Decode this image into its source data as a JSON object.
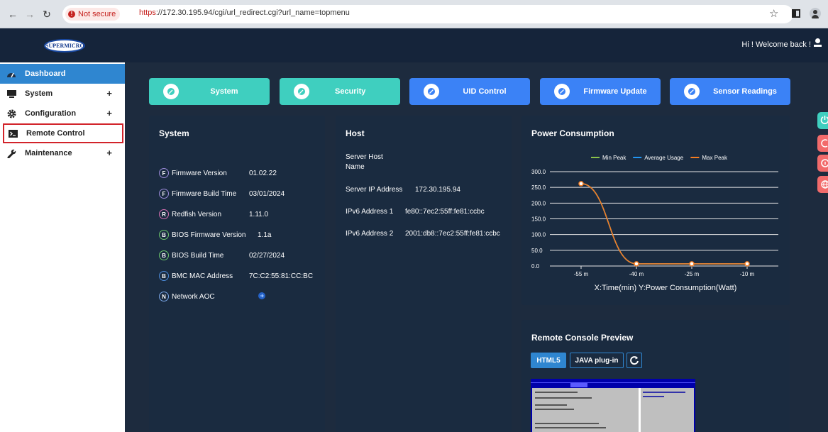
{
  "browser": {
    "not_secure": "Not secure",
    "url_scheme": "https",
    "url_rest": "://172.30.195.94/cgi/url_redirect.cgi?url_name=topmenu"
  },
  "header": {
    "logo": "SUPERMICRO",
    "welcome": "Hi ! Welcome back !"
  },
  "sidebar": {
    "items": [
      {
        "label": "Dashboard",
        "icon": "dashboard-icon",
        "expandable": false
      },
      {
        "label": "System",
        "icon": "monitor-icon",
        "expandable": true
      },
      {
        "label": "Configuration",
        "icon": "gear-icon",
        "expandable": true
      },
      {
        "label": "Remote Control",
        "icon": "terminal-icon",
        "expandable": false
      },
      {
        "label": "Maintenance",
        "icon": "wrench-icon",
        "expandable": true
      }
    ],
    "plus": "+"
  },
  "tabs": [
    {
      "label": "System",
      "color": "#3fcfbf"
    },
    {
      "label": "Security",
      "color": "#3fcfbf"
    },
    {
      "label": "UID Control",
      "color": "#3b82f6"
    },
    {
      "label": "Firmware Update",
      "color": "#3b82f6"
    },
    {
      "label": "Sensor Readings",
      "color": "#3b82f6"
    }
  ],
  "system_panel": {
    "title": "System",
    "rows": [
      {
        "badge": "F",
        "label": "Firmware Version",
        "value": "01.02.22"
      },
      {
        "badge": "F",
        "label": "Firmware Build Time",
        "value": "03/01/2024"
      },
      {
        "badge": "R",
        "label": "Redfish Version",
        "value": "1.11.0"
      },
      {
        "badge": "B",
        "label": "BIOS Firmware Version",
        "value": "1.1a"
      },
      {
        "badge": "B",
        "label": "BIOS Build Time",
        "value": "02/27/2024"
      },
      {
        "badge": "B",
        "label": "BMC MAC Address",
        "value": "7C:C2:55:81:CC:BC"
      },
      {
        "badge": "N",
        "label": "Network AOC",
        "value": ""
      }
    ]
  },
  "host_panel": {
    "title": "Host",
    "rows": [
      {
        "label": "Server Host",
        "value": ""
      },
      {
        "label": "Name",
        "value": ""
      },
      {
        "label": "Server IP Address",
        "value": "172.30.195.94"
      },
      {
        "label": "IPv6 Address 1",
        "value": "fe80::7ec2:55ff:fe81:ccbc"
      },
      {
        "label": "IPv6 Address 2",
        "value": "2001:db8::7ec2:55ff:fe81:ccbc"
      }
    ]
  },
  "power_panel": {
    "title": "Power Consumption"
  },
  "chart_data": {
    "type": "line",
    "title": "",
    "xlabel": "X:Time(min) Y:Power Consumption(Watt)",
    "ylabel": "",
    "categories": [
      "-55 m",
      "-40 m",
      "-25 m",
      "-10 m"
    ],
    "y_ticks": [
      "300.0",
      "250.0",
      "200.0",
      "150.0",
      "100.0",
      "50.0",
      "0.0"
    ],
    "ylim": [
      0,
      300
    ],
    "grid": true,
    "legend_position": "top",
    "series": [
      {
        "name": "Min Peak",
        "color": "#8bc34a",
        "values": [
          262,
          7,
          7,
          7
        ]
      },
      {
        "name": "Average Usage",
        "color": "#2196f3",
        "values": [
          262,
          7,
          7,
          7
        ]
      },
      {
        "name": "Max Peak",
        "color": "#f57c20",
        "values": [
          262,
          7,
          7,
          7
        ]
      }
    ]
  },
  "console_panel": {
    "title": "Remote Console Preview",
    "html5": "HTML5",
    "java": "JAVA plug-in"
  }
}
